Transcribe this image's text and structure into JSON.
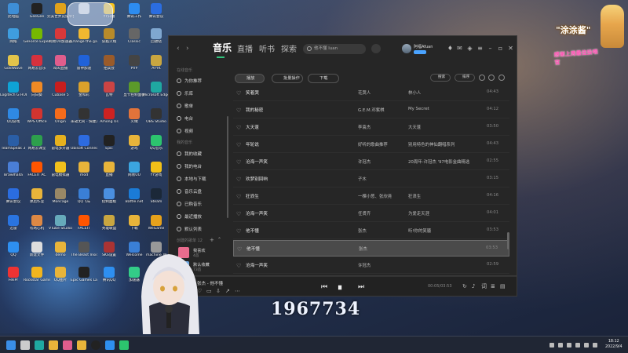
{
  "desktop": {
    "icons": [
      {
        "label": "此电脑",
        "color": "#3e8ed6"
      },
      {
        "label": "GeeGee",
        "color": "#222"
      },
      {
        "label": "完美世界竞技平台",
        "color": "#e0a21b"
      },
      {
        "label": "",
        "color": "#ddd"
      },
      {
        "label": "YY开播",
        "color": "#f7c31d"
      },
      {
        "label": "腾讯工作",
        "color": "#2d8cf0"
      },
      {
        "label": "腾讯会议",
        "color": "#2b6de0"
      },
      {
        "label": "网络",
        "color": "#3f9ddf"
      },
      {
        "label": "GeForce Experience",
        "color": "#76b900"
      },
      {
        "label": "网易UU加速器",
        "color": "#d8383a"
      },
      {
        "label": "Change the game",
        "color": "#f0b830"
      },
      {
        "label": "穿越火线",
        "color": "#b88b2a"
      },
      {
        "label": "Classic",
        "color": "#666"
      },
      {
        "label": "回收站",
        "color": "#7fa7d0"
      },
      {
        "label": "GoldWave",
        "color": "#e3c44a"
      },
      {
        "label": "网易云音乐",
        "color": "#d5313d"
      },
      {
        "label": "叫叫直播",
        "color": "#e05d8c"
      },
      {
        "label": "雷神加速",
        "color": "#2062d9"
      },
      {
        "label": "拍卖会",
        "color": "#9a5b2a"
      },
      {
        "label": "PVP",
        "color": "#444"
      },
      {
        "label": "AYYK",
        "color": "#c9a640"
      },
      {
        "label": "Logitech G HUB",
        "color": "#0fa3d5"
      },
      {
        "label": "向日葵",
        "color": "#f08a24"
      },
      {
        "label": "Cubase 5",
        "color": "#c81e1e"
      },
      {
        "label": "金和彩",
        "color": "#dba12b"
      },
      {
        "label": "瓦特",
        "color": "#c44"
      },
      {
        "label": "显卡控制面板",
        "color": "#5b9a2a"
      },
      {
        "label": "Microsoft Edge",
        "color": "#1fa8a1"
      },
      {
        "label": "QQ游戏",
        "color": "#2f89e4"
      },
      {
        "label": "WPS Office",
        "color": "#d3342f"
      },
      {
        "label": "Origin",
        "color": "#f56b1b"
      },
      {
        "label": "永劫无间 - 快捷方式",
        "color": "#333"
      },
      {
        "label": "Among Us",
        "color": "#c22"
      },
      {
        "label": "火绒",
        "color": "#e2733a"
      },
      {
        "label": "OBS Studio",
        "color": "#333"
      },
      {
        "label": "TeamSpeak 3",
        "color": "#2a5ea6"
      },
      {
        "label": "网易云课堂",
        "color": "#2d9f4c"
      },
      {
        "label": "雷电多开器",
        "color": "#e6b11e"
      },
      {
        "label": "Ubisoft Connect",
        "color": "#2d6be0"
      },
      {
        "label": "Epic",
        "color": "#222"
      },
      {
        "label": "游戏",
        "color": "#e8b43a"
      },
      {
        "label": "QQ音乐",
        "color": "#2cc46e"
      },
      {
        "label": "Brawlhalla",
        "color": "#4a7ed6"
      },
      {
        "label": "FACEIT AC",
        "color": "#ff5500"
      },
      {
        "label": "雷电模拟器",
        "color": "#f2c11c"
      },
      {
        "label": "mod",
        "color": "#e8b43a"
      },
      {
        "label": "直播",
        "color": "#e8b43a"
      },
      {
        "label": "网易UU",
        "color": "#3ba5e0"
      },
      {
        "label": "YY游戏",
        "color": "#f1c018"
      },
      {
        "label": "腾讯会议",
        "color": "#2b6de0"
      },
      {
        "label": "课后作业",
        "color": "#e8b43a"
      },
      {
        "label": "Moncage",
        "color": "#998866"
      },
      {
        "label": "QQ飞车",
        "color": "#3a7fd6"
      },
      {
        "label": "控制面板",
        "color": "#4a8fe0"
      },
      {
        "label": "Battle.net",
        "color": "#1b7bd6"
      },
      {
        "label": "Steam",
        "color": "#1b2838"
      },
      {
        "label": "迅雷",
        "color": "#2a74e0"
      },
      {
        "label": "有两心机",
        "color": "#d84"
      },
      {
        "label": "VTube Studio",
        "color": "#6ab"
      },
      {
        "label": "FACEIT",
        "color": "#ff5500"
      },
      {
        "label": "英雄联盟",
        "color": "#c9a640"
      },
      {
        "label": "下载",
        "color": "#e8b43a"
      },
      {
        "label": "WeGame",
        "color": "#e6a11b"
      },
      {
        "label": "QQ",
        "color": "#2e8ff0"
      },
      {
        "label": "新建文件",
        "color": "#ddd"
      },
      {
        "label": "demo",
        "color": "#e8b43a"
      },
      {
        "label": "The Beast Inside",
        "color": "#555"
      },
      {
        "label": "SKS设置",
        "color": "#a33"
      },
      {
        "label": "Welcome",
        "color": "#3a7fd6"
      },
      {
        "label": "machine_M",
        "color": "#999"
      },
      {
        "label": "FeliPr",
        "color": "#e33"
      },
      {
        "label": "Rockstar Games",
        "color": "#f2b51e"
      },
      {
        "label": "QQ图片",
        "color": "#e8b43a"
      },
      {
        "label": "Epic Games Launcher",
        "color": "#222"
      },
      {
        "label": "腾讯QQ",
        "color": "#2e8ff0"
      },
      {
        "label": "加速器",
        "color": "#3c8"
      },
      {
        "label": "网易有道",
        "color": "#e33"
      }
    ]
  },
  "overlay": {
    "mascot_title": "\"涂涂酱\"",
    "mascot_sub": "感谢上周最佳投喂官",
    "counter": "1967734"
  },
  "music": {
    "nav_back": "‹",
    "nav_forward": "›",
    "tabs": [
      {
        "label": "音乐",
        "active": true
      },
      {
        "label": "直播",
        "active": false
      },
      {
        "label": "听书",
        "active": false
      },
      {
        "label": "探索",
        "active": false
      }
    ],
    "search_placeholder": "他不懂 luan",
    "user_name": "阿福Afuan",
    "sidebar": {
      "section_online": "在线音乐",
      "online_items": [
        "为你推荐",
        "乐库",
        "歌单",
        "电台",
        "视频"
      ],
      "section_mine": "我的音乐",
      "mine_items": [
        "我的收藏",
        "我的电台",
        "本地与下载",
        "音乐云盘",
        "已购音乐",
        "最近播放",
        "默认列表"
      ],
      "section_playlists": "创建的歌单 12",
      "playlists": [
        {
          "name": "我喜欢",
          "count": "4首"
        },
        {
          "name": "默认收藏",
          "count": "73首"
        }
      ]
    },
    "toolbar": {
      "play": "播放",
      "batch": "批量操作",
      "download": "下载",
      "right_btn1": "搜索",
      "right_btn2": "排序"
    },
    "songs": [
      {
        "title": "笑着哭",
        "singer": "花哭人",
        "album": "林小人",
        "duration": "04:43"
      },
      {
        "title": "我的秘密",
        "singer": "G.E.M.邓紫棋",
        "album": "My Secret",
        "duration": "04:12"
      },
      {
        "title": "大天蓬",
        "singer": "李袁杰",
        "album": "大天蓬",
        "duration": "03:50"
      },
      {
        "title": "年轮说",
        "singer": "好听的歌曲推荐",
        "album": "别用特色的神仙翻唱系列",
        "duration": "04:43"
      },
      {
        "title": "沧海一声笑",
        "singer": "许冠杰",
        "album": "20周年-许冠杰 '97电影金曲精选",
        "duration": "02:55"
      },
      {
        "title": "欢梦别回响",
        "singer": "子木",
        "album": "",
        "duration": "03:15"
      },
      {
        "title": "狂浪生",
        "singer": "一棵小葱、张欣尧",
        "album": "狂浪生",
        "duration": "04:16"
      },
      {
        "title": "沧海一声笑",
        "singer": "任贤齐",
        "album": "为爱走天涯",
        "duration": "04:01"
      },
      {
        "title": "他不懂",
        "singer": "张杰",
        "album": "听!你的笑靥",
        "duration": "03:53"
      },
      {
        "title": "他不懂",
        "singer": "张杰",
        "album": "",
        "duration": "03:53"
      },
      {
        "title": "沧海一声笑",
        "singer": "许冠杰",
        "album": "",
        "duration": "02:59"
      },
      {
        "title": "沧海一声笑",
        "singer": "GAI周延",
        "album": "歌手第二季 第一期",
        "duration": "04:15"
      }
    ],
    "selected_index": 9,
    "player": {
      "now_playing": "张杰 - 他不懂",
      "time": "00:05/03:53",
      "progress": 0.02
    }
  },
  "taskbar": {
    "time": "18:12",
    "date": "2022/9/4"
  }
}
